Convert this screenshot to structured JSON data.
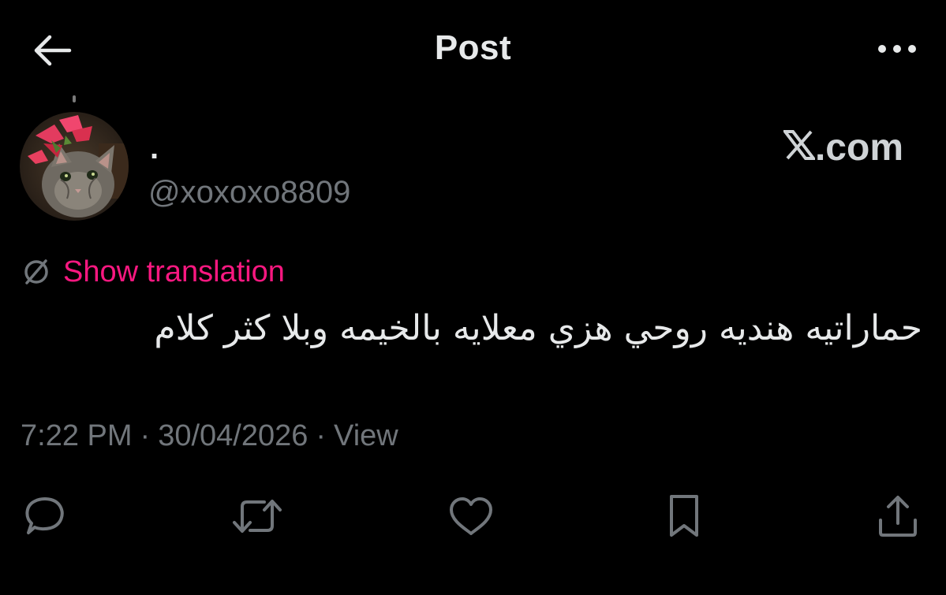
{
  "header": {
    "title": "Post",
    "back_icon": "arrow-left-icon",
    "more_icon": "more-horizontal-icon"
  },
  "author": {
    "display_name": ".",
    "handle": "@xoxoxo8809",
    "avatar": "cat-with-pink-flower-avatar"
  },
  "watermark": {
    "text": ".com",
    "brand_icon": "x-logo-icon"
  },
  "translation": {
    "label": "Show translation",
    "icon": "translate-globe-icon",
    "color": "#f91880"
  },
  "post": {
    "text": "حماراتيه هنديه روحي هزي معلايه بالخيمه وبلا كثر كلام"
  },
  "meta": {
    "time": "7:22 PM",
    "separator": "·",
    "date": "30/04/2026",
    "view_label": "View"
  },
  "actions": [
    {
      "name": "reply",
      "icon": "reply-bubble-icon"
    },
    {
      "name": "repost",
      "icon": "repost-arrows-icon"
    },
    {
      "name": "like",
      "icon": "heart-icon"
    },
    {
      "name": "bookmark",
      "icon": "bookmark-icon"
    },
    {
      "name": "share",
      "icon": "share-upload-icon"
    }
  ],
  "colors": {
    "background": "#000000",
    "primary_text": "#e7e9ea",
    "secondary_text": "#71767b",
    "accent": "#f91880"
  }
}
